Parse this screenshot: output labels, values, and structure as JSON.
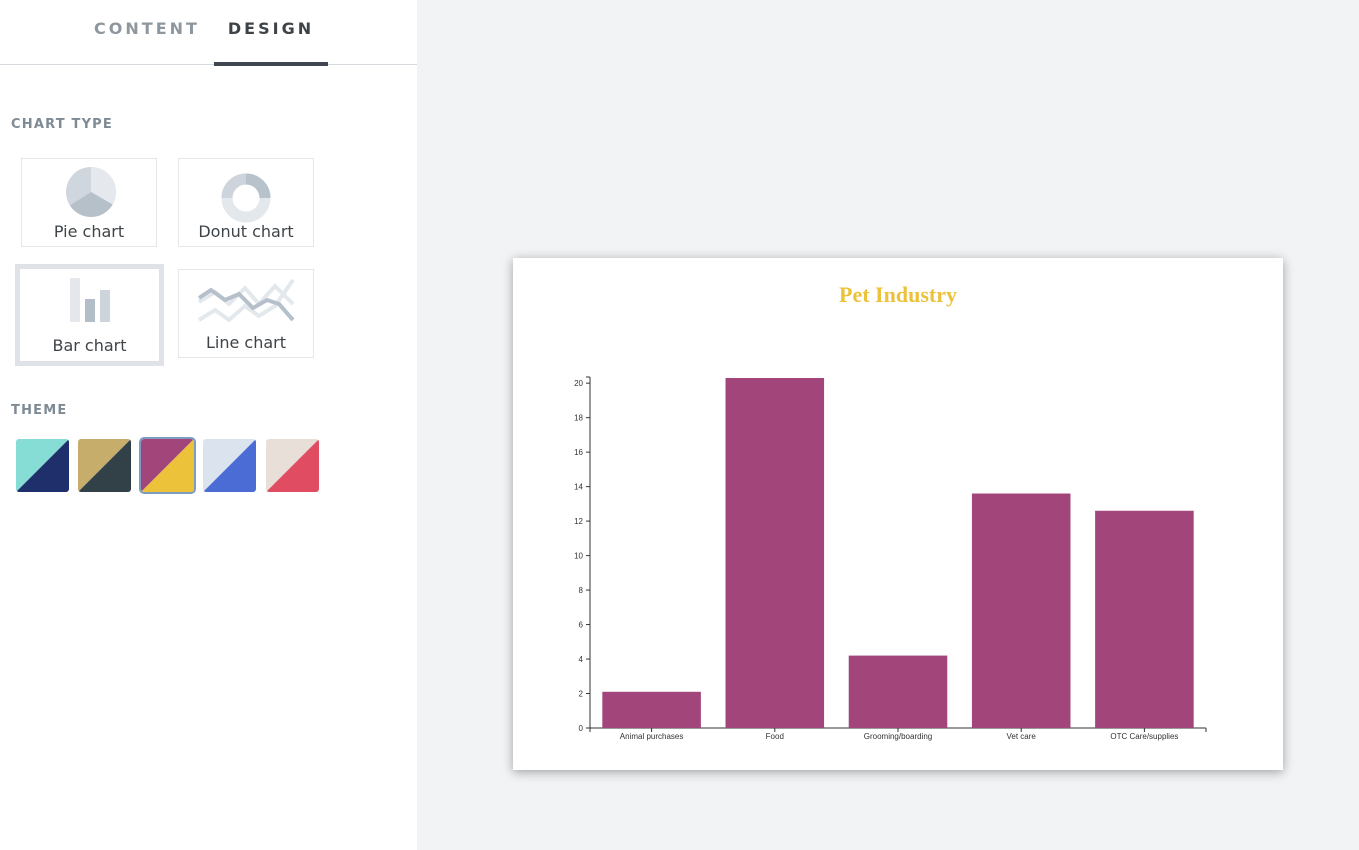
{
  "tabs": [
    {
      "label": "CONTENT"
    },
    {
      "label": "DESIGN",
      "active": true
    }
  ],
  "sections": {
    "chart_type": "CHART TYPE",
    "theme": "THEME"
  },
  "chart_types": [
    {
      "label": "Pie chart",
      "icon": "pie-chart-icon"
    },
    {
      "label": "Donut chart",
      "icon": "donut-chart-icon"
    },
    {
      "label": "Bar chart",
      "icon": "bar-chart-icon",
      "selected": true
    },
    {
      "label": "Line chart",
      "icon": "line-chart-icon"
    }
  ],
  "themes": [
    {
      "colors": [
        "#86ddd6",
        "#1f2f6b"
      ]
    },
    {
      "colors": [
        "#c6ad6c",
        "#324048"
      ]
    },
    {
      "colors": [
        "#a2457a",
        "#ecc23a"
      ],
      "selected": true
    },
    {
      "colors": [
        "#dbe3ee",
        "#4a6cd4"
      ]
    },
    {
      "colors": [
        "#e8e0d8",
        "#e04d63"
      ]
    }
  ],
  "colors": {
    "bar": "#a2457a",
    "title": "#ecc23a"
  },
  "chart_data": {
    "type": "bar",
    "title": "Pet Industry",
    "categories": [
      "Animal purchases",
      "Food",
      "Grooming/boarding",
      "Vet care",
      "OTC Care/supplies"
    ],
    "values": [
      2.1,
      20.3,
      4.2,
      13.6,
      12.6
    ],
    "ylim": [
      0,
      20.3
    ],
    "yticks": [
      0,
      2,
      4,
      6,
      8,
      10,
      12,
      14,
      16,
      18,
      20
    ],
    "xlabel": "",
    "ylabel": "",
    "grid": false,
    "legend": "none"
  }
}
